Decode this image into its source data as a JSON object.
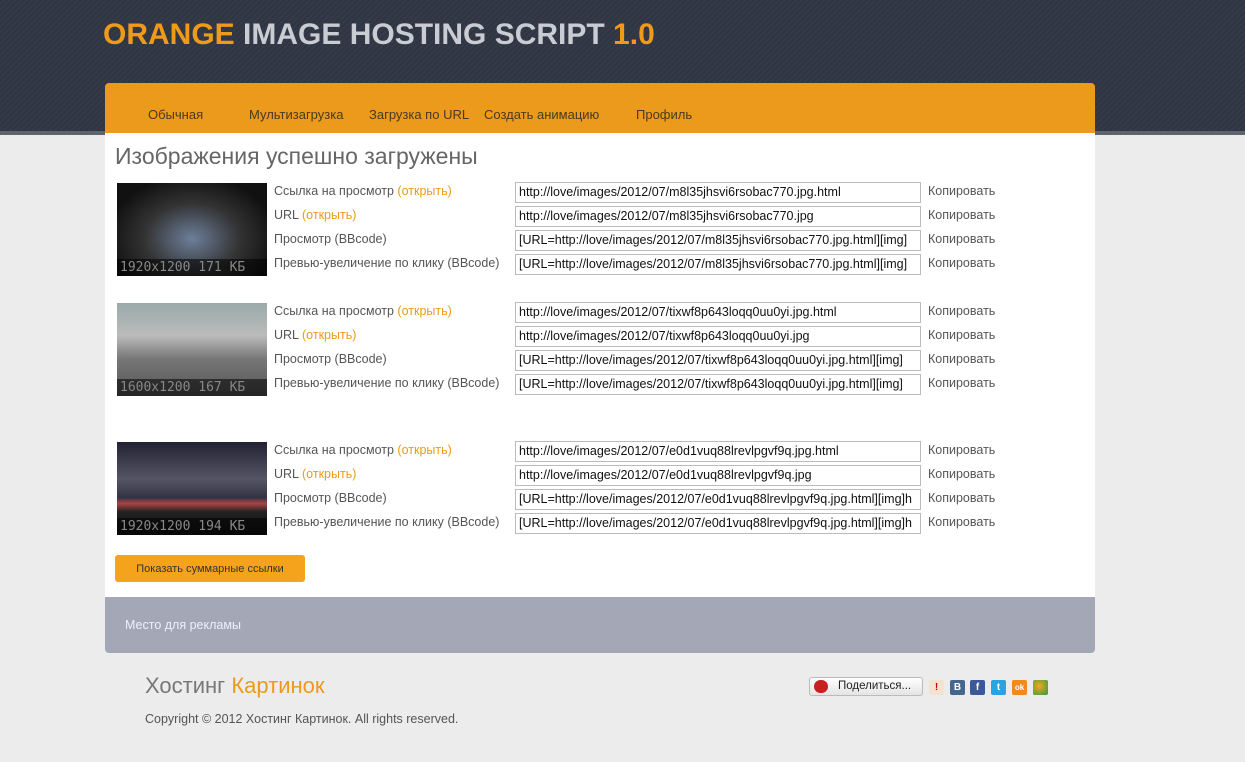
{
  "header": {
    "logo_a": "ORANGE",
    "logo_b": " IMAGE HOSTING SCRIPT ",
    "logo_c": "1.0"
  },
  "nav": [
    "Обычная",
    "Мультизагрузка",
    "Загрузка по URL",
    "Создать анимацию",
    "Профиль"
  ],
  "title": "Изображения успешно загружены",
  "labels": {
    "view": "Ссылка на просмотр ",
    "url": "URL ",
    "bb": "Просмотр (BBcode)",
    "zoom": "Превью-увеличение по клику (BBcode)",
    "open": "(открыть)",
    "copy": "Копировать"
  },
  "images": [
    {
      "caption": "1920x1200 171 КБ",
      "links": [
        "http://love/images/2012/07/m8l35jhsvi6rsobac770.jpg.html",
        "http://love/images/2012/07/m8l35jhsvi6rsobac770.jpg",
        "[URL=http://love/images/2012/07/m8l35jhsvi6rsobac770.jpg.html][img]",
        "[URL=http://love/images/2012/07/m8l35jhsvi6rsobac770.jpg.html][img]"
      ]
    },
    {
      "caption": "1600x1200 167 КБ",
      "links": [
        "http://love/images/2012/07/tixwf8p643loqq0uu0yi.jpg.html",
        "http://love/images/2012/07/tixwf8p643loqq0uu0yi.jpg",
        "[URL=http://love/images/2012/07/tixwf8p643loqq0uu0yi.jpg.html][img]",
        "[URL=http://love/images/2012/07/tixwf8p643loqq0uu0yi.jpg.html][img]"
      ]
    },
    {
      "caption": "1920x1200 194 КБ",
      "links": [
        "http://love/images/2012/07/e0d1vuq88lrevlpgvf9q.jpg.html",
        "http://love/images/2012/07/e0d1vuq88lrevlpgvf9q.jpg",
        "[URL=http://love/images/2012/07/e0d1vuq88lrevlpgvf9q.jpg.html][img]h",
        "[URL=http://love/images/2012/07/e0d1vuq88lrevlpgvf9q.jpg.html][img]h"
      ]
    }
  ],
  "summary_button": "Показать суммарные ссылки",
  "ad": "Место для рекламы",
  "footer": {
    "logo_a": "Хостинг ",
    "logo_b": "Картинок",
    "copyright": "Copyright © 2012 Хостинг Картинок. All rights reserved.",
    "share": "Поделиться..."
  },
  "social": [
    {
      "name": "vk",
      "glyph": "В",
      "color": "#45668e"
    },
    {
      "name": "facebook",
      "glyph": "f",
      "color": "#3b5998"
    },
    {
      "name": "twitter",
      "glyph": "t",
      "color": "#2aa3e0"
    },
    {
      "name": "odnoklassniki",
      "glyph": "ok",
      "color": "#f08a1a"
    }
  ]
}
